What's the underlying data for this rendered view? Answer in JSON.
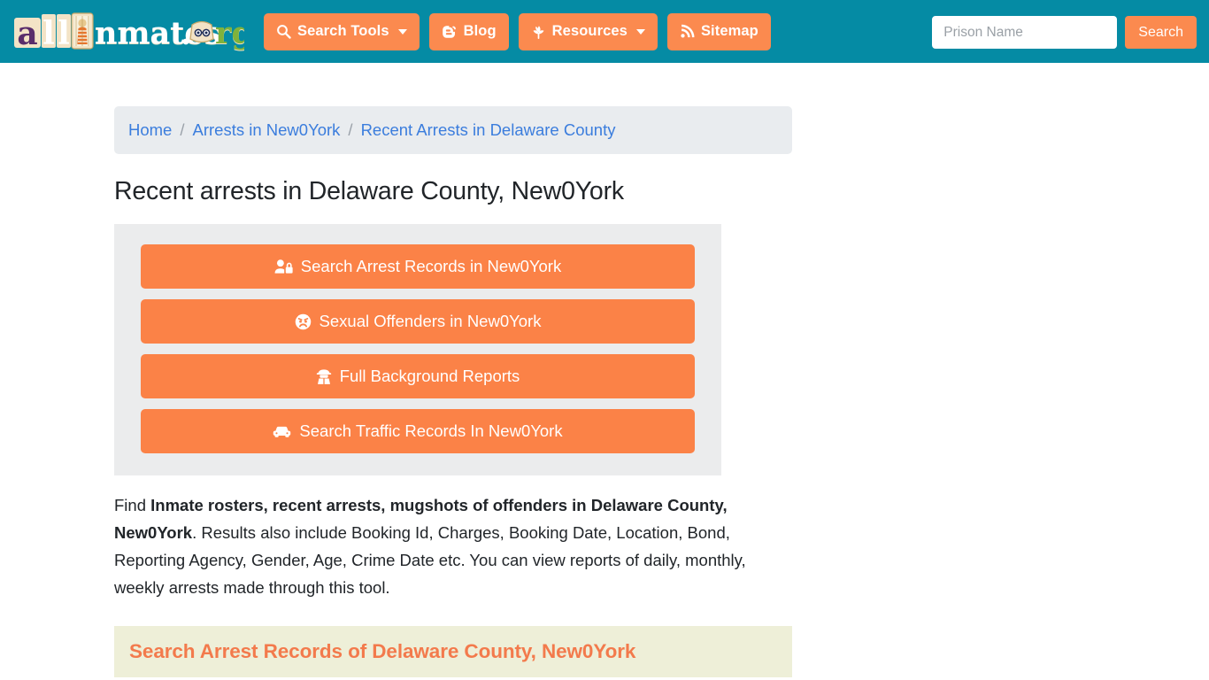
{
  "header": {
    "brand": {
      "text_part1": "all",
      "text_part2": "nmates",
      "text_part3": ".",
      "text_part4": "rg",
      "alt": "allInmates.org"
    },
    "nav": [
      {
        "label": "Search Tools",
        "icon": "search-icon",
        "has_caret": true
      },
      {
        "label": "Blog",
        "icon": "blogger-icon",
        "has_caret": false
      },
      {
        "label": "Resources",
        "icon": "leaf-icon",
        "has_caret": true
      },
      {
        "label": "Sitemap",
        "icon": "rss-icon",
        "has_caret": false
      }
    ],
    "search": {
      "placeholder": "Prison Name",
      "value": "",
      "button_label": "Search"
    }
  },
  "breadcrumb": {
    "items": [
      {
        "label": "Home"
      },
      {
        "label": "Arrests in New0York"
      },
      {
        "label": "Recent Arrests in Delaware County"
      }
    ],
    "separator": "/"
  },
  "main": {
    "page_title": "Recent arrests in Delaware County, New0York",
    "cta_buttons": [
      {
        "label": "Search Arrest Records in New0York",
        "icon": "user-lock-icon"
      },
      {
        "label": "Sexual Offenders in New0York",
        "icon": "angry-face-icon"
      },
      {
        "label": "Full Background Reports",
        "icon": "user-secret-icon"
      },
      {
        "label": "Search Traffic Records In New0York",
        "icon": "car-icon"
      }
    ],
    "lead": {
      "prefix": "Find ",
      "bold": "Inmate rosters, recent arrests, mugshots of offenders in Delaware County, New0York",
      "suffix": ". Results also include Booking Id, Charges, Booking Date, Location, Bond, Reporting Agency, Gender, Age, Crime Date etc. You can view reports of daily, monthly, weekly arrests made through this tool."
    },
    "section_heading": "Search Arrest Records of Delaware County, New0York"
  },
  "colors": {
    "header_teal": "#058BA4",
    "accent_orange": "#FB8247",
    "breadcrumb_bg": "#E9ECEF",
    "breadcrumb_link": "#3B7DDD",
    "panel_gray": "#EBECED",
    "band_bg": "#EEEFD8",
    "band_text": "#F37A4C"
  }
}
